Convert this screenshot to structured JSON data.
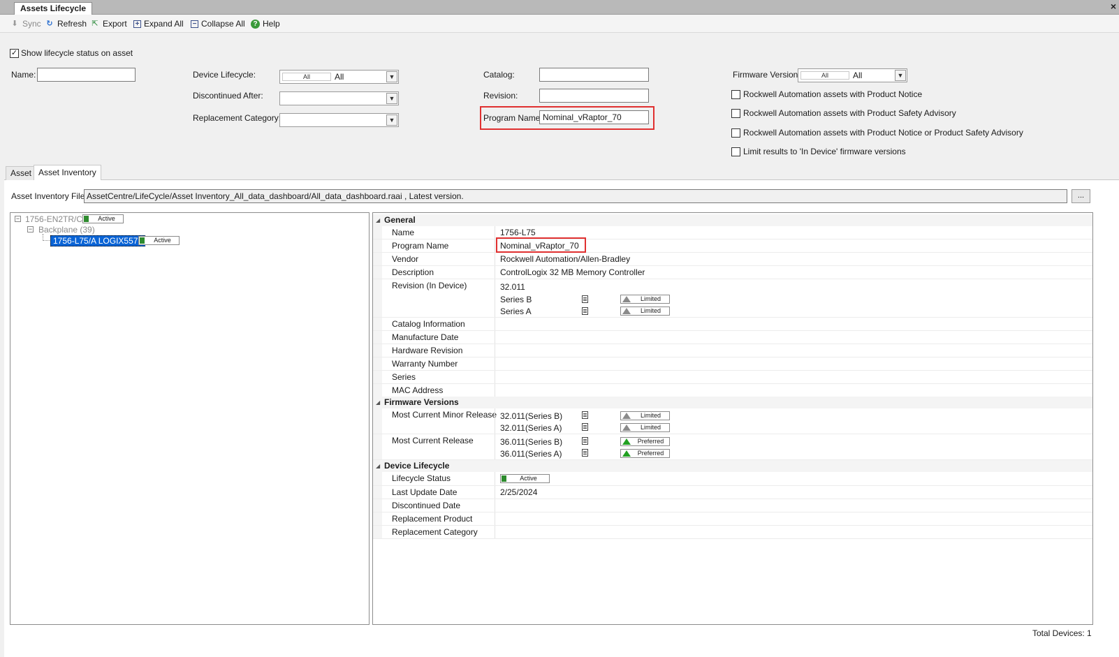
{
  "window": {
    "tab_title": "Assets Lifecycle",
    "close_glyph": "×"
  },
  "toolbar": {
    "sync": "Sync",
    "refresh": "Refresh",
    "export": "Export",
    "expand_all": "Expand All",
    "collapse_all": "Collapse All",
    "help": "Help"
  },
  "filters": {
    "show_lifecycle_label": "Show lifecycle status on asset",
    "name_label": "Name:",
    "name_value": "",
    "device_lifecycle_label": "Device Lifecycle:",
    "device_lifecycle_mini": "All",
    "device_lifecycle_value": "All",
    "discontinued_after_label": "Discontinued After:",
    "replacement_category_label": "Replacement Category:",
    "catalog_label": "Catalog:",
    "catalog_value": "",
    "revision_label": "Revision:",
    "revision_value": "",
    "program_name_label": "Program Name:",
    "program_name_value": "Nominal_vRaptor_70",
    "firmware_version_label": "Firmware Version:",
    "firmware_mini": "All",
    "firmware_value": "All",
    "cb_product_notice": "Rockwell Automation assets with Product Notice",
    "cb_safety_advisory": "Rockwell Automation assets with Product Safety Advisory",
    "cb_notice_or_advisory": "Rockwell Automation assets with Product Notice or Product Safety Advisory",
    "cb_limit_in_device": "Limit results to 'In Device' firmware versions"
  },
  "tabs": {
    "asset": "Asset",
    "asset_inventory": "Asset Inventory"
  },
  "inventory": {
    "file_label": "Asset Inventory File:",
    "file_path": "AssetCentre/LifeCycle/Asset Inventory_All_data_dashboard/All_data_dashboard.raai , Latest version.",
    "browse": "..."
  },
  "tree": {
    "root": "1756-EN2TR/C",
    "root_status": "Active",
    "backplane": "Backplane (39)",
    "selected": "1756-L75/A LOGIX5575",
    "selected_status": "Active"
  },
  "props": {
    "general": "General",
    "name_k": "Name",
    "name_v": "1756-L75",
    "program_k": "Program Name",
    "program_v": "Nominal_vRaptor_70",
    "vendor_k": "Vendor",
    "vendor_v": "Rockwell Automation/Allen-Bradley",
    "desc_k": "Description",
    "desc_v": "ControlLogix 32 MB Memory Controller",
    "rev_k": "Revision (In Device)",
    "rev_v": "32.011",
    "rev_series_b": "Series B",
    "rev_series_a": "Series A",
    "rev_status_b": "Limited",
    "rev_status_a": "Limited",
    "catalog_info": "Catalog Information",
    "mfg_date": "Manufacture Date",
    "hw_rev": "Hardware Revision",
    "warranty": "Warranty Number",
    "series": "Series",
    "mac": "MAC Address",
    "firmware": "Firmware Versions",
    "minor_k": "Most Current Minor Release",
    "minor_b": "32.011(Series B)",
    "minor_a": "32.011(Series A)",
    "minor_status_b": "Limited",
    "minor_status_a": "Limited",
    "current_k": "Most Current Release",
    "current_b": "36.011(Series B)",
    "current_a": "36.011(Series A)",
    "current_status_b": "Preferred",
    "current_status_a": "Preferred",
    "device_lifecycle": "Device Lifecycle",
    "lc_status_k": "Lifecycle Status",
    "lc_status_v": "Active",
    "last_update_k": "Last Update Date",
    "last_update_v": "2/25/2024",
    "disc_date_k": "Discontinued Date",
    "repl_product_k": "Replacement Product",
    "repl_category_k": "Replacement Category"
  },
  "status": {
    "total_devices": "Total Devices: 1"
  },
  "colors": {
    "accent_highlight": "#e03030",
    "selection": "#0a64d6",
    "active_green": "#2e8b2e",
    "preferred_green": "#22a022"
  }
}
